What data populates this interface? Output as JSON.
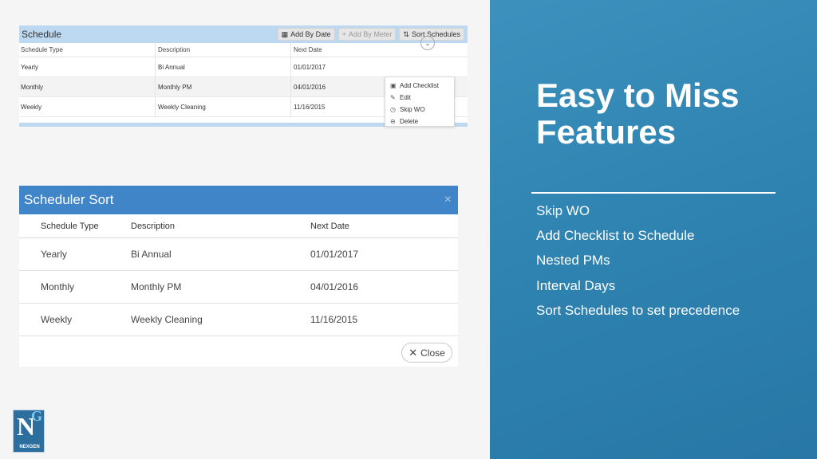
{
  "schedule_panel": {
    "title": "Schedule",
    "buttons": [
      {
        "icon": "calendar-icon",
        "label": "Add By Date",
        "enabled": true
      },
      {
        "icon": "plus-icon",
        "label": "Add By Meter",
        "enabled": false
      },
      {
        "icon": "sort-icon",
        "label": "Sort Schedules",
        "enabled": true
      }
    ],
    "columns": [
      "Schedule Type",
      "Description",
      "Next Date"
    ],
    "rows": [
      {
        "type": "Yearly",
        "description": "Bi Annual",
        "next_date": "01/01/2017"
      },
      {
        "type": "Monthly",
        "description": "Monthly PM",
        "next_date": "04/01/2016"
      },
      {
        "type": "Weekly",
        "description": "Weekly Cleaning",
        "next_date": "11/16/2015"
      }
    ],
    "context_menu": [
      {
        "icon": "clipboard-icon",
        "label": "Add Checklist"
      },
      {
        "icon": "pencil-icon",
        "label": "Edit"
      },
      {
        "icon": "clock-icon",
        "label": "Skip WO"
      },
      {
        "icon": "minus-circle-icon",
        "label": "Delete"
      }
    ]
  },
  "sort_dialog": {
    "title": "Scheduler Sort",
    "close_icon": "×",
    "columns": [
      "Schedule Type",
      "Description",
      "Next Date"
    ],
    "rows": [
      {
        "type": "Yearly",
        "description": "Bi Annual",
        "next_date": "01/01/2017"
      },
      {
        "type": "Monthly",
        "description": "Monthly PM",
        "next_date": "04/01/2016"
      },
      {
        "type": "Weekly",
        "description": "Weekly Cleaning",
        "next_date": "11/16/2015"
      }
    ],
    "close_button_label": "Close"
  },
  "logo": {
    "letter_n": "N",
    "letter_g": "G",
    "text": "NEXGEN"
  },
  "slide": {
    "heading_line1": "Easy to Miss",
    "heading_line2": "Features",
    "bullets": [
      "Skip WO",
      "Add Checklist to Schedule",
      "Nested PMs",
      "Interval Days",
      "Sort Schedules to set precedence"
    ]
  },
  "colors": {
    "panel_blue": "#3c91bd",
    "dialog_header": "#3f85c8",
    "schedule_header": "#bcd9f1"
  }
}
